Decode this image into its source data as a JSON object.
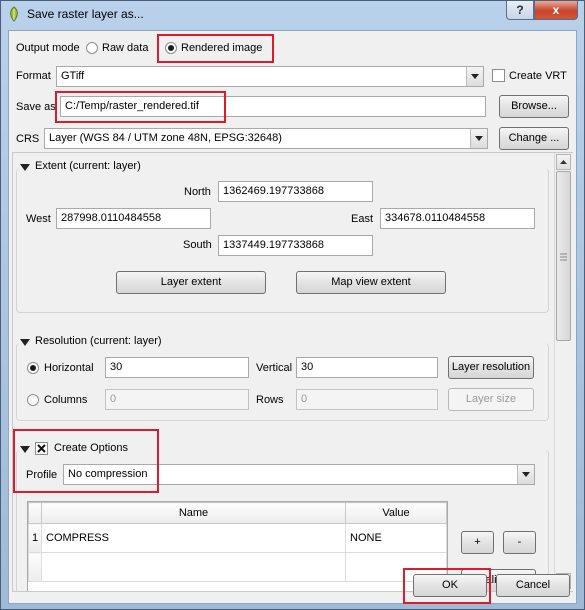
{
  "window": {
    "title": "Save raster layer as...",
    "help": "?",
    "close": "x"
  },
  "output_mode": {
    "label": "Output mode",
    "raw": "Raw data",
    "rendered": "Rendered image",
    "selected": "rendered"
  },
  "format": {
    "label": "Format",
    "value": "GTiff",
    "create_vrt": "Create VRT"
  },
  "save_as": {
    "label": "Save as",
    "value": "C:/Temp/raster_rendered.tif",
    "browse": "Browse..."
  },
  "crs": {
    "label": "CRS",
    "value": "Layer (WGS 84 / UTM zone 48N, EPSG:32648)",
    "change": "Change ..."
  },
  "extent": {
    "title": "Extent (current: layer)",
    "north_label": "North",
    "north": "1362469.197733868",
    "west_label": "West",
    "west": "287998.0110484558",
    "east_label": "East",
    "east": "334678.0110484558",
    "south_label": "South",
    "south": "1337449.197733868",
    "layer_extent": "Layer extent",
    "map_view_extent": "Map view extent"
  },
  "resolution": {
    "title": "Resolution (current: layer)",
    "horizontal_label": "Horizontal",
    "horizontal": "30",
    "vertical_label": "Vertical",
    "vertical": "30",
    "layer_resolution": "Layer resolution",
    "columns_label": "Columns",
    "columns": "0",
    "rows_label": "Rows",
    "rows": "0",
    "layer_size": "Layer size"
  },
  "create_options": {
    "title": "Create Options",
    "checked": true,
    "profile_label": "Profile",
    "profile": "No compression",
    "headers": [
      "Name",
      "Value"
    ],
    "rows": [
      {
        "index": "1",
        "name": "COMPRESS",
        "value": "NONE"
      }
    ],
    "add": "+",
    "remove": "-",
    "validate": "Validate"
  },
  "buttons": {
    "ok": "OK",
    "cancel": "Cancel"
  }
}
